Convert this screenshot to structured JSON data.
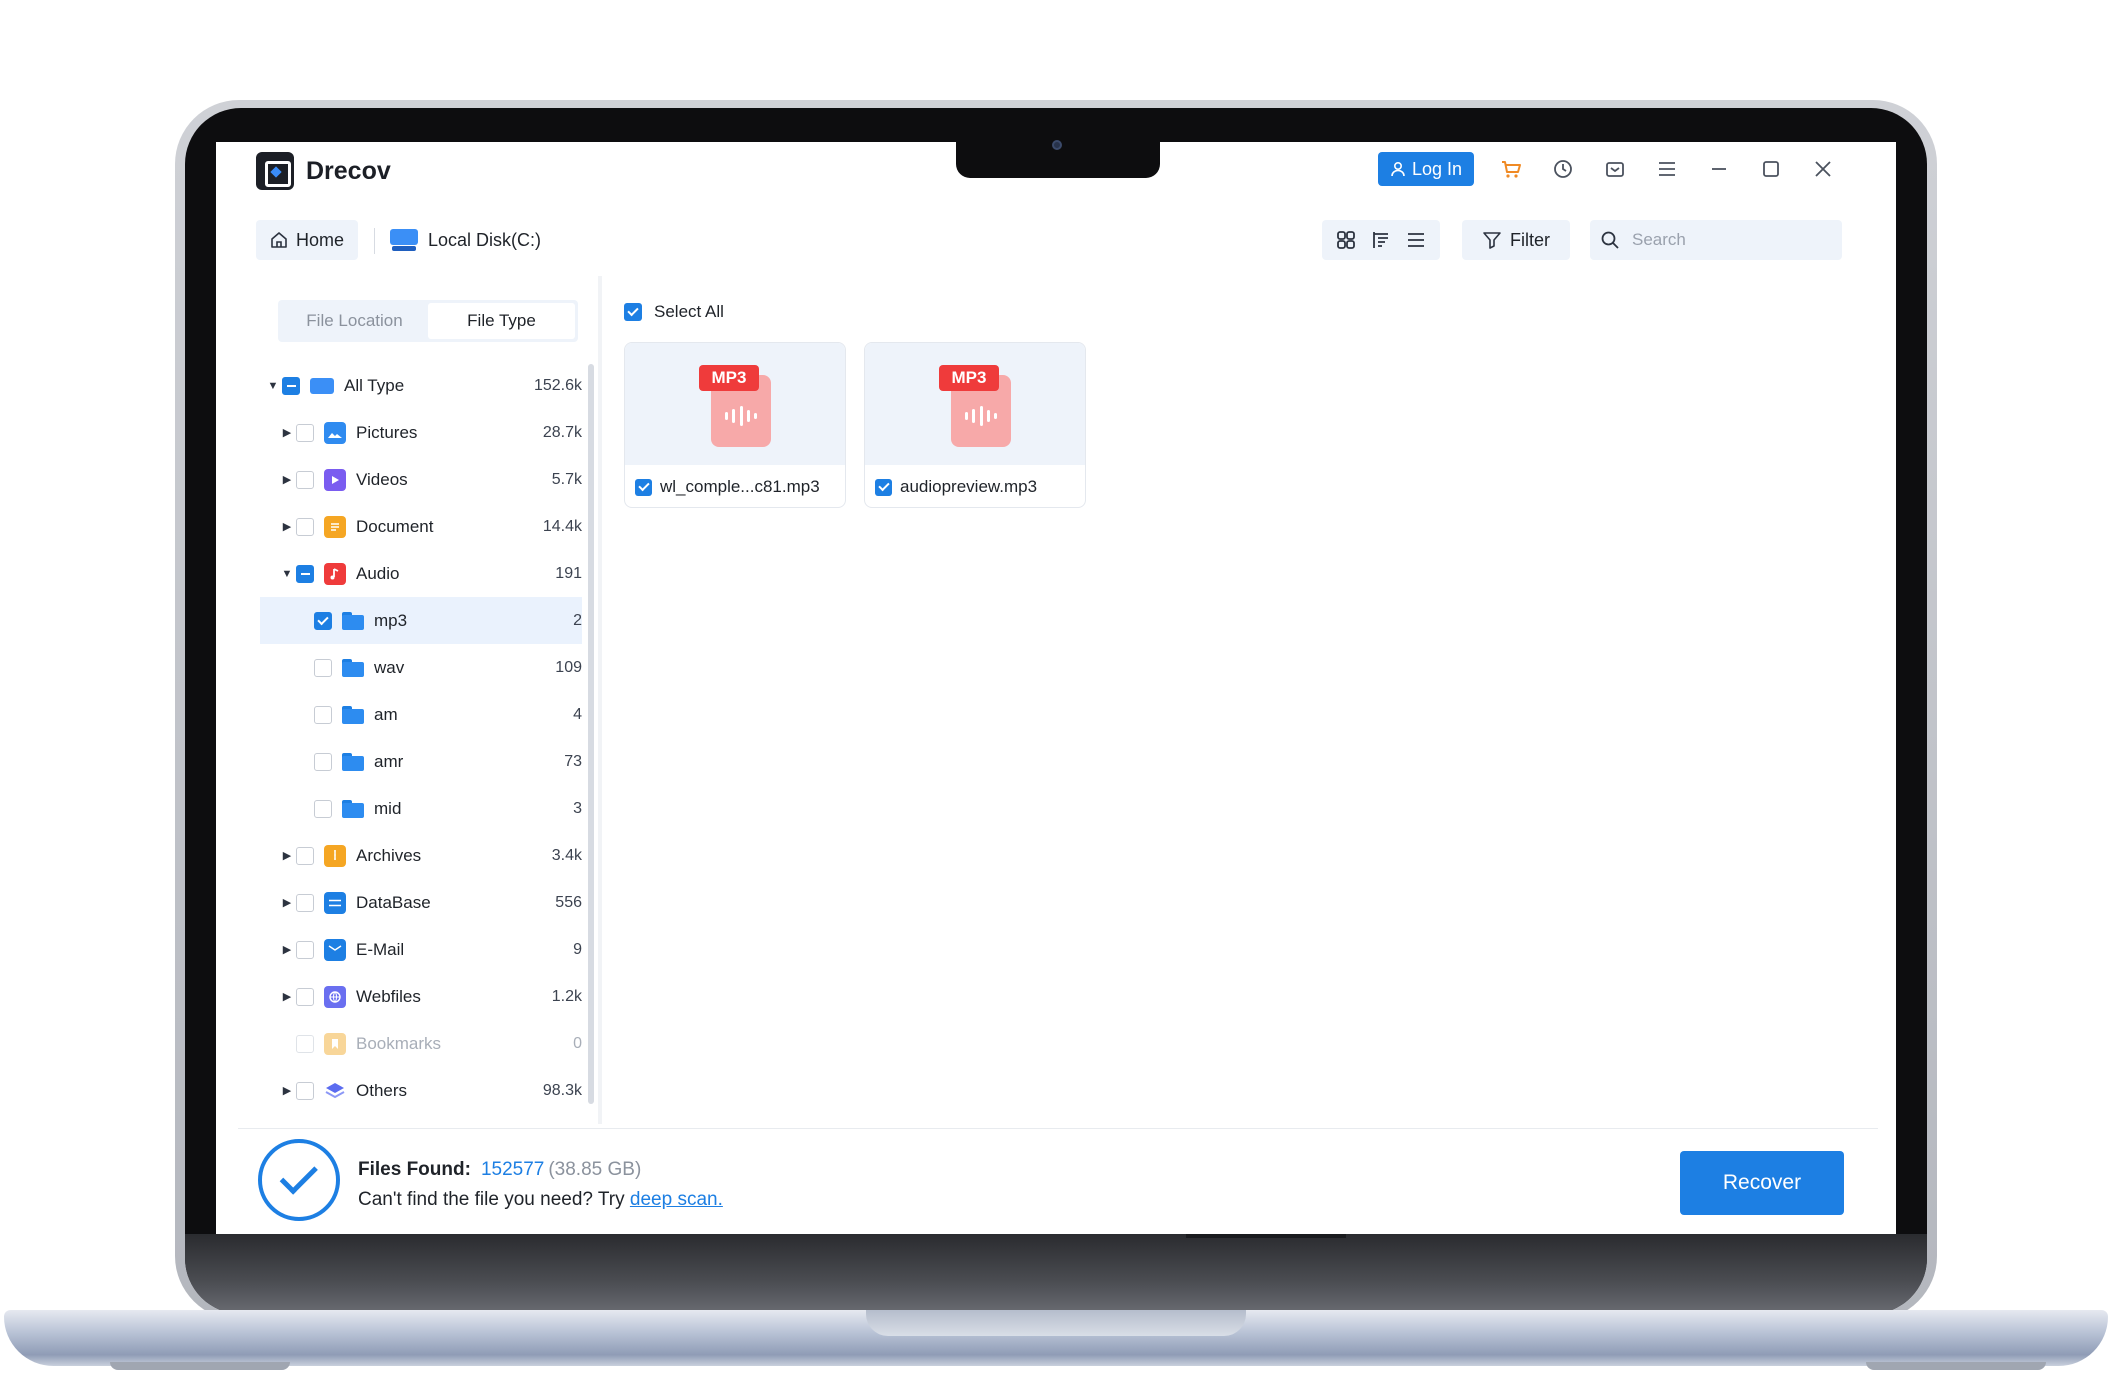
{
  "app": {
    "title": "Drecov",
    "login_label": "Log In"
  },
  "toolbar": {
    "home_label": "Home",
    "location_label": "Local Disk(C:)",
    "filter_label": "Filter",
    "search_placeholder": "Search"
  },
  "sidebar": {
    "tabs": [
      {
        "label": "File Location",
        "active": false
      },
      {
        "label": "File Type",
        "active": true
      }
    ],
    "tree": [
      {
        "label": "All Type",
        "count": "152.6k",
        "level": 0,
        "expanded": true,
        "check": "partial",
        "icon": "drive-icon"
      },
      {
        "label": "Pictures",
        "count": "28.7k",
        "level": 1,
        "expanded": false,
        "check": "none",
        "icon": "image-icon"
      },
      {
        "label": "Videos",
        "count": "5.7k",
        "level": 1,
        "expanded": false,
        "check": "none",
        "icon": "video-icon"
      },
      {
        "label": "Document",
        "count": "14.4k",
        "level": 1,
        "expanded": false,
        "check": "none",
        "icon": "document-icon"
      },
      {
        "label": "Audio",
        "count": "191",
        "level": 1,
        "expanded": true,
        "check": "partial",
        "icon": "audio-icon"
      },
      {
        "label": "mp3",
        "count": "2",
        "level": 2,
        "check": "checked",
        "icon": "folder-icon",
        "selected": true
      },
      {
        "label": "wav",
        "count": "109",
        "level": 2,
        "check": "none",
        "icon": "folder-icon"
      },
      {
        "label": "am",
        "count": "4",
        "level": 2,
        "check": "none",
        "icon": "folder-icon"
      },
      {
        "label": "amr",
        "count": "73",
        "level": 2,
        "check": "none",
        "icon": "folder-icon"
      },
      {
        "label": "mid",
        "count": "3",
        "level": 2,
        "check": "none",
        "icon": "folder-icon"
      },
      {
        "label": "Archives",
        "count": "3.4k",
        "level": 1,
        "expanded": false,
        "check": "none",
        "icon": "archive-icon"
      },
      {
        "label": "DataBase",
        "count": "556",
        "level": 1,
        "expanded": false,
        "check": "none",
        "icon": "database-icon"
      },
      {
        "label": "E-Mail",
        "count": "9",
        "level": 1,
        "expanded": false,
        "check": "none",
        "icon": "email-icon"
      },
      {
        "label": "Webfiles",
        "count": "1.2k",
        "level": 1,
        "expanded": false,
        "check": "none",
        "icon": "web-icon"
      },
      {
        "label": "Bookmarks",
        "count": "0",
        "level": 1,
        "check": "none",
        "icon": "bookmark-folder-icon",
        "disabled": true
      },
      {
        "label": "Others",
        "count": "98.3k",
        "level": 1,
        "expanded": false,
        "check": "none",
        "icon": "layers-icon"
      }
    ]
  },
  "content": {
    "select_all_label": "Select All",
    "files": [
      {
        "name": "wl_comple...c81.mp3",
        "badge": "MP3",
        "checked": true
      },
      {
        "name": "audiopreview.mp3",
        "badge": "MP3",
        "checked": true
      }
    ]
  },
  "status": {
    "found_label": "Files Found:",
    "found_count": "152577",
    "found_size": "(38.85 GB)",
    "hint_text": "Can't find the file you need? Try ",
    "hint_link": "deep scan.",
    "recover_label": "Recover"
  },
  "colors": {
    "accent": "#1d7fe3",
    "panel_bg": "#eef3fa",
    "mp3_badge": "#ef3b3b"
  }
}
